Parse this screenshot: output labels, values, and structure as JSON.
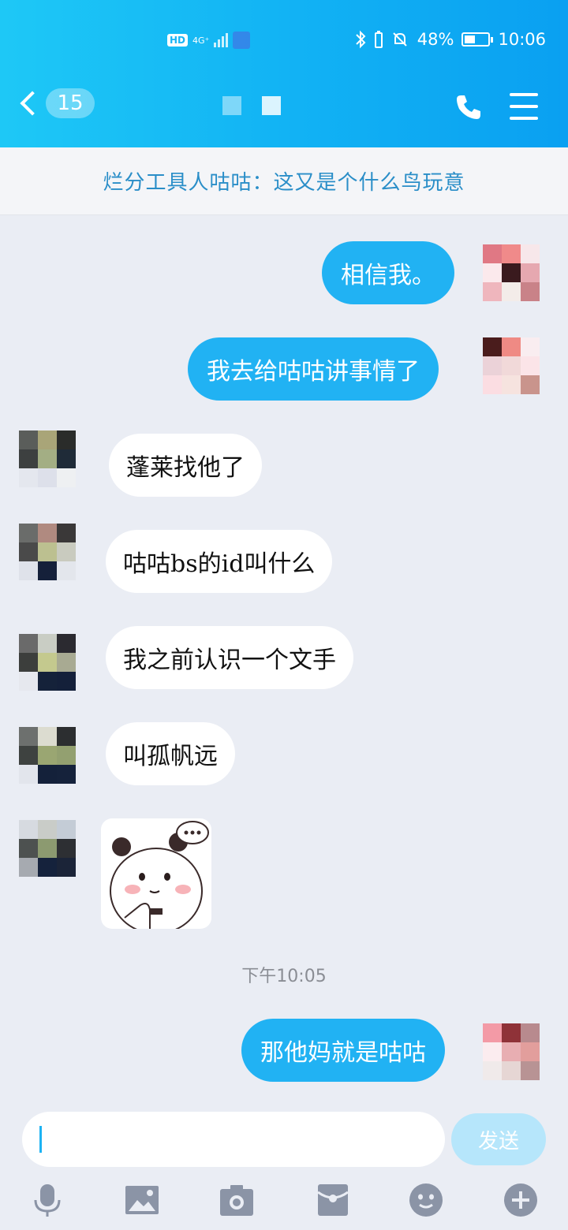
{
  "status_bar": {
    "network_badge": "HD",
    "network_type": "4G⁺",
    "battery_percent": "48%",
    "battery_level": 0.48,
    "time": "10:06"
  },
  "header": {
    "unread_count": "15",
    "accent": "#12b3f4"
  },
  "notice": {
    "text": "烂分工具人咕咕：这又是个什么鸟玩意"
  },
  "messages": [
    {
      "direction": "out",
      "text": "相信我。"
    },
    {
      "direction": "out",
      "text": "我去给咕咕讲事情了"
    },
    {
      "direction": "in",
      "text": "蓬莱找他了"
    },
    {
      "direction": "in",
      "text": "咕咕bs的id叫什么"
    },
    {
      "direction": "in",
      "text": "我之前认识一个文手"
    },
    {
      "direction": "in",
      "text": "叫孤帆远"
    },
    {
      "direction": "in",
      "type": "sticker",
      "sticker": "panda-sticker"
    },
    {
      "type": "timestamp",
      "text": "下午10:05"
    },
    {
      "direction": "out",
      "text": "那他妈就是咕咕"
    }
  ],
  "input": {
    "value": "",
    "send_label": "发送"
  },
  "toolbar": [
    "mic-icon",
    "image-icon",
    "camera-icon",
    "red-packet-icon",
    "emoji-icon",
    "plus-icon"
  ]
}
